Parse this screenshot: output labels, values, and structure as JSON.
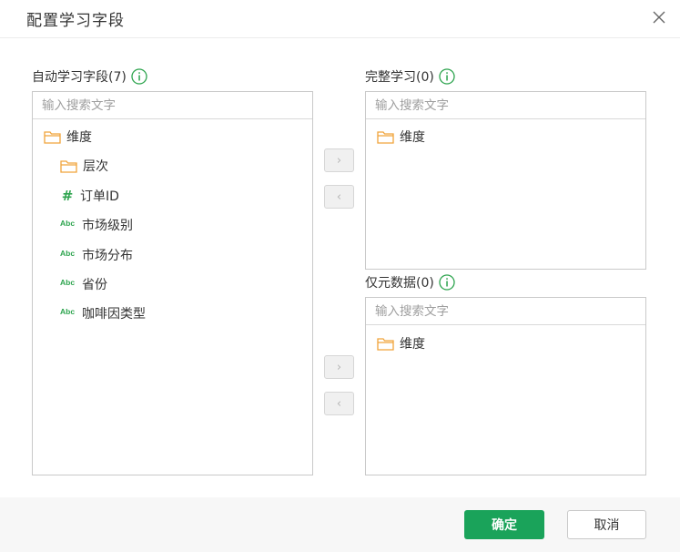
{
  "dialog": {
    "title": "配置学习字段"
  },
  "left_panel": {
    "label": "自动学习字段(7)",
    "search_placeholder": "输入搜索文字",
    "items": [
      {
        "label": "维度",
        "icon": "folder-icon"
      },
      {
        "label": "层次",
        "icon": "folder-icon"
      },
      {
        "label": "订单ID",
        "icon": "hash-icon"
      },
      {
        "label": "市场级别",
        "icon": "abc-icon"
      },
      {
        "label": "市场分布",
        "icon": "abc-icon"
      },
      {
        "label": "省份",
        "icon": "abc-icon"
      },
      {
        "label": "咖啡因类型",
        "icon": "abc-icon"
      }
    ]
  },
  "icons": {
    "hash": "#",
    "abc": "Abc"
  },
  "complete_panel": {
    "label": "完整学习(0)",
    "search_placeholder": "输入搜索文字",
    "items": [
      {
        "label": "维度",
        "icon": "folder-icon"
      }
    ]
  },
  "meta_panel": {
    "label": "仅元数据(0)",
    "search_placeholder": "输入搜索文字",
    "items": [
      {
        "label": "维度",
        "icon": "folder-icon"
      }
    ]
  },
  "arrows": {
    "right": "›",
    "left": "‹"
  },
  "footer": {
    "ok_label": "确定",
    "cancel_label": "取消"
  },
  "colors": {
    "primary": "#1aa35a",
    "folder": "#f0a33a",
    "field_type": "#2da44e"
  }
}
